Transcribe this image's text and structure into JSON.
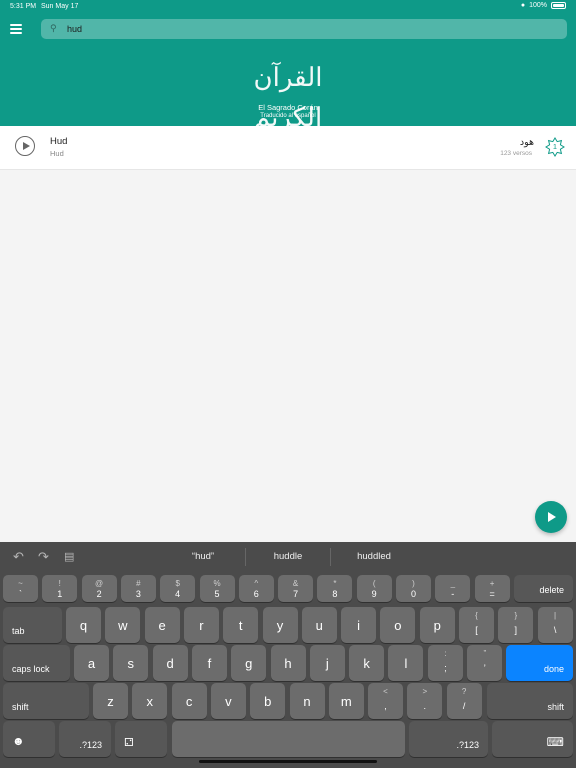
{
  "status_bar": {
    "time": "5:31 PM",
    "date": "Sun May 17",
    "battery": "100%"
  },
  "search": {
    "value": "hud"
  },
  "header": {
    "logo_arabic": "القرآن الكريم",
    "title": "El Sagrado Corán",
    "subtitle": "Traducido al español"
  },
  "results": [
    {
      "name": "Hud",
      "subtitle": "Hud",
      "arabic": "هود",
      "verses": "123 versos",
      "number": "1"
    }
  ],
  "keyboard": {
    "suggestions": [
      "“hud”",
      "huddle",
      "huddled"
    ],
    "row1": [
      {
        "top": "~",
        "bot": "`"
      },
      {
        "top": "!",
        "bot": "1"
      },
      {
        "top": "@",
        "bot": "2"
      },
      {
        "top": "#",
        "bot": "3"
      },
      {
        "top": "$",
        "bot": "4"
      },
      {
        "top": "%",
        "bot": "5"
      },
      {
        "top": "^",
        "bot": "6"
      },
      {
        "top": "&",
        "bot": "7"
      },
      {
        "top": "*",
        "bot": "8"
      },
      {
        "top": "(",
        "bot": "9"
      },
      {
        "top": ")",
        "bot": "0"
      },
      {
        "top": "_",
        "bot": "-"
      },
      {
        "top": "+",
        "bot": "="
      }
    ],
    "delete": "delete",
    "tab": "tab",
    "row2": [
      "q",
      "w",
      "e",
      "r",
      "t",
      "y",
      "u",
      "i",
      "o",
      "p"
    ],
    "row2_extra": [
      {
        "top": "{",
        "bot": "["
      },
      {
        "top": "}",
        "bot": "]"
      },
      {
        "top": "|",
        "bot": "\\"
      }
    ],
    "caps_lock": "caps lock",
    "row3": [
      "a",
      "s",
      "d",
      "f",
      "g",
      "h",
      "j",
      "k",
      "l"
    ],
    "row3_extra": [
      {
        "top": ":",
        "bot": ";"
      },
      {
        "top": "”",
        "bot": "’"
      }
    ],
    "done": "done",
    "shift": "shift",
    "row4": [
      "z",
      "x",
      "c",
      "v",
      "b",
      "n",
      "m"
    ],
    "row4_extra": [
      {
        "top": "<",
        "bot": ","
      },
      {
        "top": ">",
        "bot": "."
      },
      {
        "top": "?",
        "bot": "/"
      }
    ],
    "numbers": ".?123"
  }
}
